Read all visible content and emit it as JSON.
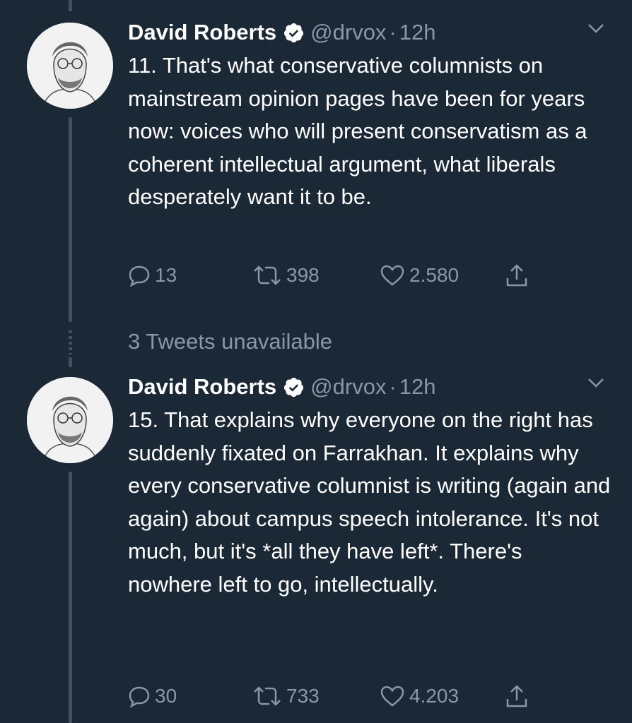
{
  "colors": {
    "background": "#1b2836",
    "secondary_text": "#8899a6",
    "verified": "#ffffff",
    "thread_line": "#3d5466"
  },
  "tweets": [
    {
      "author_name": "David Roberts",
      "handle": "@drvox",
      "separator": "·",
      "time": "12h",
      "verified_icon": "verified-badge-icon",
      "text": "11. That's what conservative columnists on mainstream opinion pages have been for years now: voices who will present conservatism as a coherent intellectual argument, what liberals desperately want it to be.",
      "replies": "13",
      "retweets": "398",
      "likes": "2.580"
    },
    {
      "author_name": "David Roberts",
      "handle": "@drvox",
      "separator": "·",
      "time": "12h",
      "verified_icon": "verified-badge-icon",
      "text": "15. That explains why everyone on the right has suddenly fixated on Farrakhan. It explains why every conservative columnist is writing (again and again) about campus speech intolerance. It's not much, but it's *all they have left*. There's nowhere left to go, intellectually.",
      "replies": "30",
      "retweets": "733",
      "likes": "4.203"
    }
  ],
  "unavailable_notice": "3 Tweets unavailable"
}
